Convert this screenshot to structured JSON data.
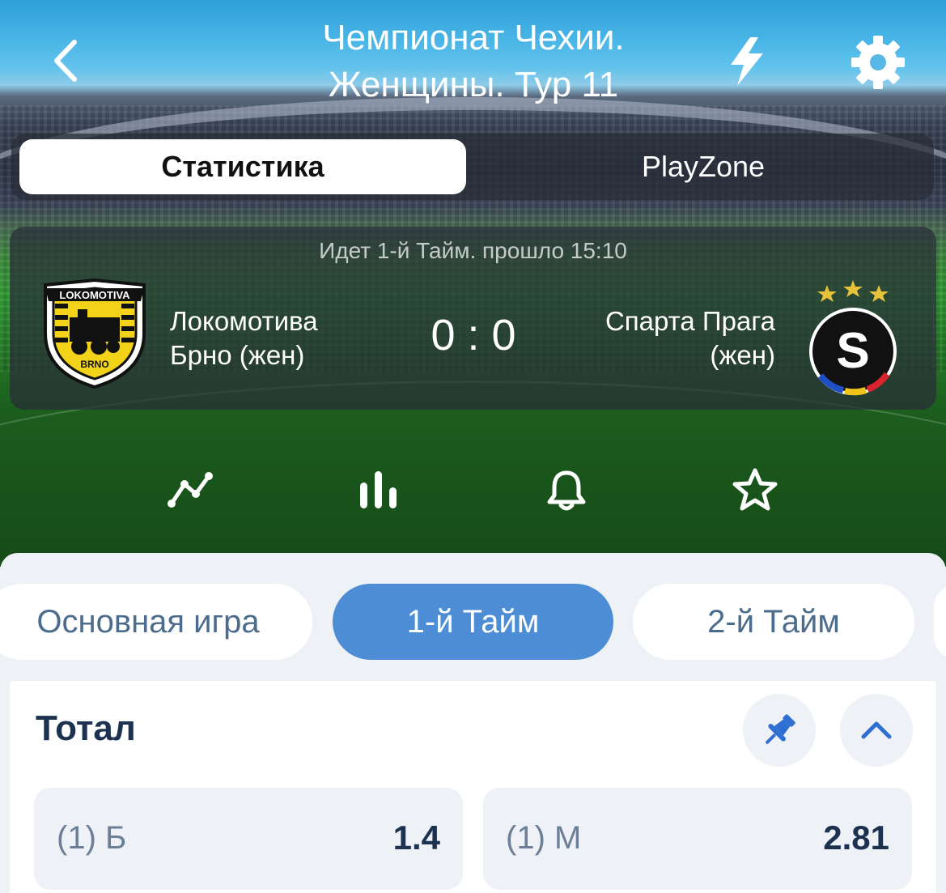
{
  "header": {
    "title_line1": "Чемпионат Чехии.",
    "title_line2": "Женщины. Тур 11"
  },
  "segment": {
    "active": "Статистика",
    "other": "PlayZone"
  },
  "match": {
    "status": "Идет 1-й Тайм. прошло 15:10",
    "home_line1": "Локомотива",
    "home_line2": "Брно (жен)",
    "away_line1": "Спарта Прага",
    "away_line2": "(жен)",
    "score": "0 : 0",
    "home_logo_text": "LOKOMOTIVA BRNO HORNI HERŠPICE",
    "away_logo_text": "S"
  },
  "icons": [
    "stats-line-icon",
    "bar-chart-icon",
    "bell-icon",
    "star-icon"
  ],
  "periods": {
    "items": [
      "Основная игра",
      "1-й Тайм",
      "2-й Тайм"
    ],
    "selected": "1-й Тайм"
  },
  "market": {
    "title": "Тотал",
    "odds": [
      {
        "label": "(1) Б",
        "value": "1.4"
      },
      {
        "label": "(1) М",
        "value": "2.81"
      }
    ]
  },
  "colors": {
    "accent": "#4c8dd6",
    "text_dark": "#1d3250",
    "chip_text": "#4b6c8c"
  }
}
